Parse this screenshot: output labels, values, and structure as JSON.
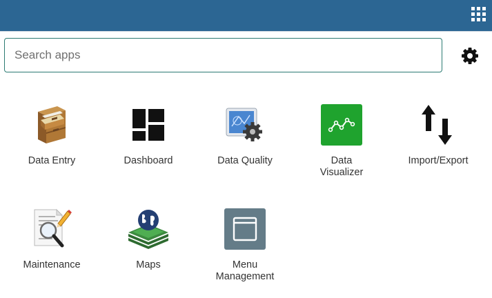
{
  "header": {
    "apps_menu_icon": "apps-grid-icon",
    "background_color": "#2c6693"
  },
  "search": {
    "placeholder": "Search apps",
    "value": ""
  },
  "settings": {
    "icon": "gear-icon"
  },
  "apps": [
    {
      "label": "Data Entry",
      "icon": "file-cabinet-icon"
    },
    {
      "label": "Dashboard",
      "icon": "dashboard-tiles-icon"
    },
    {
      "label": "Data Quality",
      "icon": "blueprint-gear-icon"
    },
    {
      "label": "Data\nVisualizer",
      "icon": "line-chart-icon",
      "color": "#1fa32e"
    },
    {
      "label": "Import/Export",
      "icon": "up-down-arrows-icon"
    },
    {
      "label": "Maintenance",
      "icon": "document-magnifier-icon"
    },
    {
      "label": "Maps",
      "icon": "globe-layers-icon"
    },
    {
      "label": "Menu\nManagement",
      "icon": "window-icon",
      "color": "#647c88"
    }
  ]
}
